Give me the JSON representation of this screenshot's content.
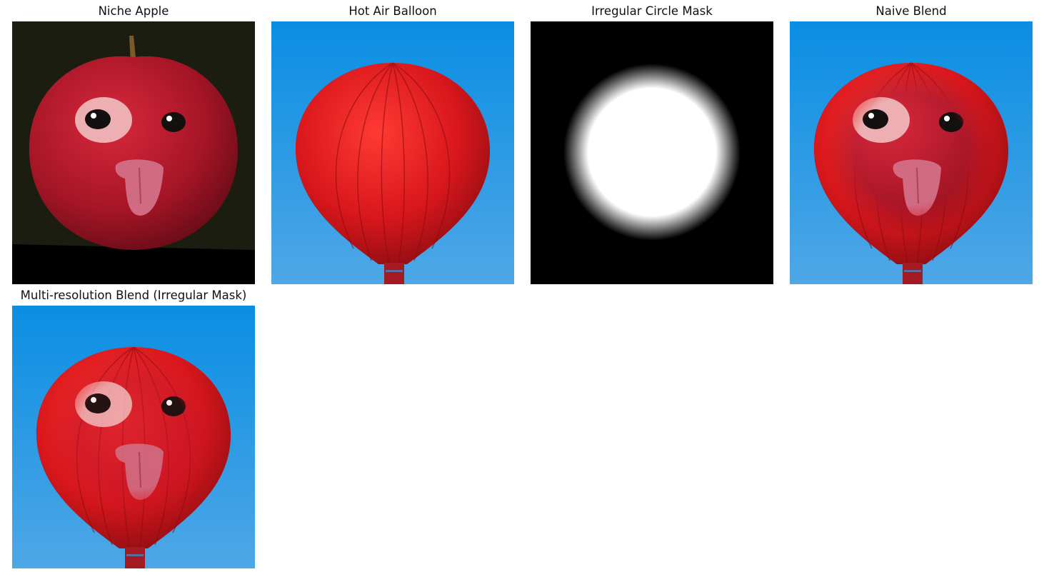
{
  "panels": [
    {
      "title": "Niche Apple"
    },
    {
      "title": "Hot Air Balloon"
    },
    {
      "title": "Irregular Circle Mask"
    },
    {
      "title": "Naive Blend"
    },
    {
      "title": "Multi-resolution Blend (Irregular Mask)"
    }
  ],
  "colors": {
    "sky_top": "#0a8ee3",
    "sky_bottom": "#4ea7e6",
    "balloon_red": "#d8171c",
    "apple_red": "#b0182a",
    "mask_black": "#000000",
    "mask_white": "#ffffff"
  }
}
